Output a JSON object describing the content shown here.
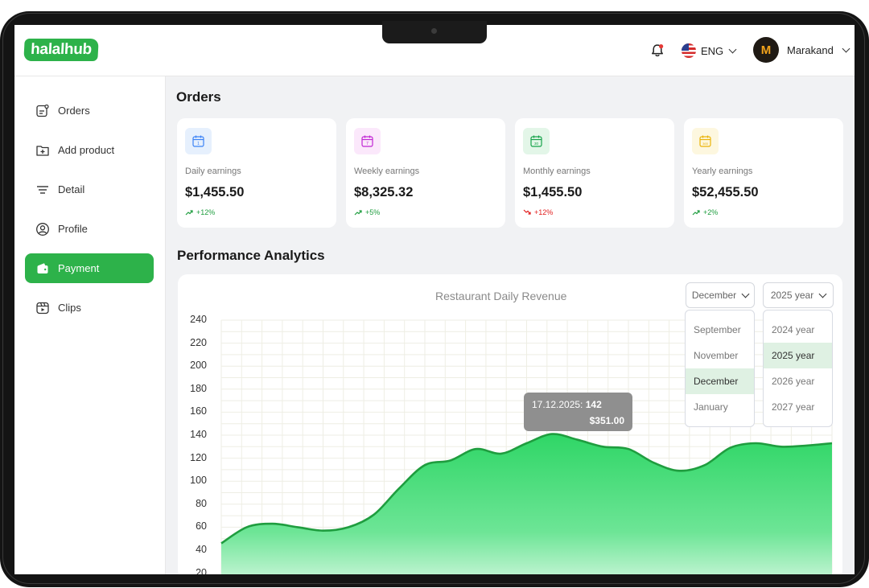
{
  "app": {
    "logo": "halalhub"
  },
  "topbar": {
    "language": "ENG",
    "user_name": "Marakand",
    "avatar_letter": "M"
  },
  "sidebar": {
    "items": [
      {
        "label": "Orders",
        "icon": "orders-icon"
      },
      {
        "label": "Add product",
        "icon": "add-product-icon"
      },
      {
        "label": "Detail",
        "icon": "detail-icon"
      },
      {
        "label": "Profile",
        "icon": "profile-icon"
      },
      {
        "label": "Payment",
        "icon": "wallet-icon",
        "active": true
      },
      {
        "label": "Clips",
        "icon": "clips-icon"
      }
    ]
  },
  "orders": {
    "title": "Orders",
    "cards": [
      {
        "label": "Daily earnings",
        "value": "$1,455.50",
        "trend": "+12%",
        "direction": "up",
        "calendar_day": "1",
        "accent": "#3b82f6",
        "tint": "#e6f0fd"
      },
      {
        "label": "Weekly earnings",
        "value": "$8,325.32",
        "trend": "+5%",
        "direction": "up",
        "calendar_day": "7",
        "accent": "#c026d3",
        "tint": "#fbe8fb"
      },
      {
        "label": "Monthly earnings",
        "value": "$1,455.50",
        "trend": "+12%",
        "direction": "down",
        "calendar_day": "30",
        "accent": "#16a34a",
        "tint": "#e3f6e8"
      },
      {
        "label": "Yearly earnings",
        "value": "$52,455.50",
        "trend": "+2%",
        "direction": "up",
        "calendar_day": "365",
        "accent": "#eab308",
        "tint": "#fdf7df"
      }
    ]
  },
  "analytics": {
    "title": "Performance Analytics",
    "month_select": {
      "value": "December",
      "options": [
        "September",
        "November",
        "December",
        "January"
      ]
    },
    "year_select": {
      "value": "2025 year",
      "options": [
        "2024 year",
        "2025 year",
        "2026 year",
        "2027 year"
      ]
    },
    "tooltip": {
      "date": "17.12.2025:",
      "count": "142",
      "amount": "$351.00"
    }
  },
  "colors": {
    "brand": "#2db24a",
    "up": "#1f9d3f",
    "down": "#e11d1d"
  },
  "chart_data": {
    "type": "area",
    "title": "Restaurant Daily Revenue",
    "y_ticks": [
      "240",
      "220",
      "200",
      "180",
      "160",
      "140",
      "120",
      "100",
      "80",
      "60",
      "40",
      "20"
    ],
    "ylim": [
      20,
      240
    ],
    "grid": true,
    "x": [
      0,
      1,
      2,
      3,
      4,
      5,
      6,
      7,
      8,
      9,
      10,
      11,
      12,
      13,
      14,
      15,
      16,
      17,
      18,
      19,
      20,
      21,
      22,
      23,
      24
    ],
    "series": [
      {
        "values": [
          46,
          60,
          63,
          60,
          57,
          60,
          71,
          94,
          114,
          118,
          128,
          124,
          133,
          141,
          136,
          130,
          128,
          116,
          109,
          114,
          129,
          133,
          130,
          131,
          133
        ]
      }
    ]
  }
}
